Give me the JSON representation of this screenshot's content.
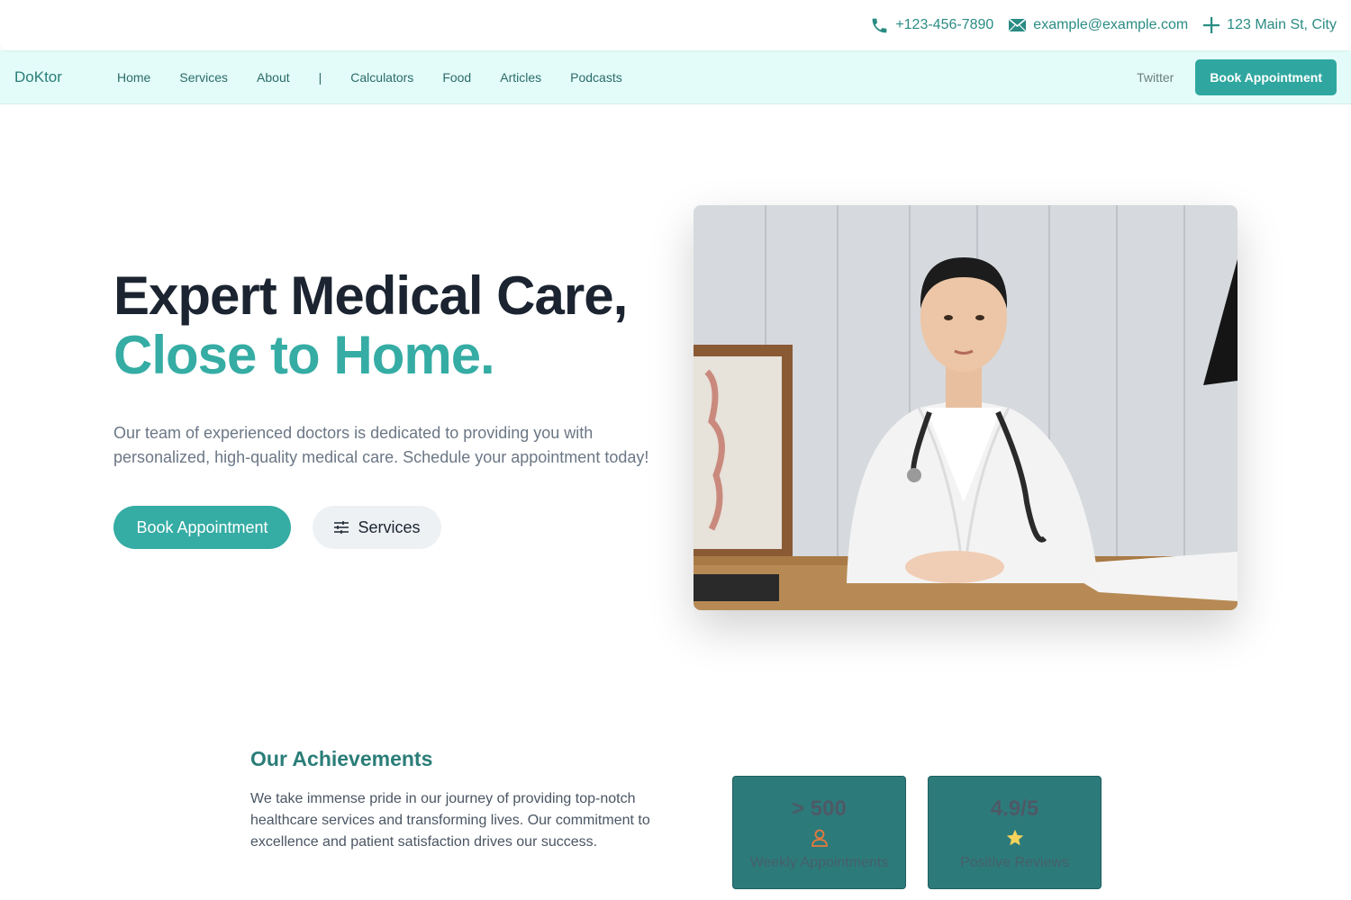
{
  "topbar": {
    "phone": "+123-456-7890",
    "email": "example@example.com",
    "address": "123 Main St, City",
    "icon_color": "#2a8c84"
  },
  "nav": {
    "brand": "DoKtor",
    "links": [
      "Home",
      "Services",
      "About",
      "|",
      "Calculators",
      "Food",
      "Articles",
      "Podcasts"
    ],
    "twitter": "Twitter",
    "cta": "Book Appointment"
  },
  "hero": {
    "title_line1": "Expert Medical Care,",
    "title_line2": "Close to Home.",
    "description": "Our team of experienced doctors is dedicated to providing you with personalized, high-quality medical care. Schedule your appointment today!",
    "primary_button": "Book Appointment",
    "secondary_button": "Services",
    "accent_color": "#35aca4"
  },
  "achievements": {
    "title": "Our Achievements",
    "description": "We take immense pride in our journey of providing top-notch healthcare services and transforming lives. Our commitment to excellence and patient satisfaction drives our success.",
    "stats": [
      {
        "value": "> 500",
        "label": "Weekly Appointments",
        "icon": "user-icon"
      },
      {
        "value": "4.9/5",
        "label": "Positive Reviews",
        "icon": "star-icon"
      }
    ]
  }
}
